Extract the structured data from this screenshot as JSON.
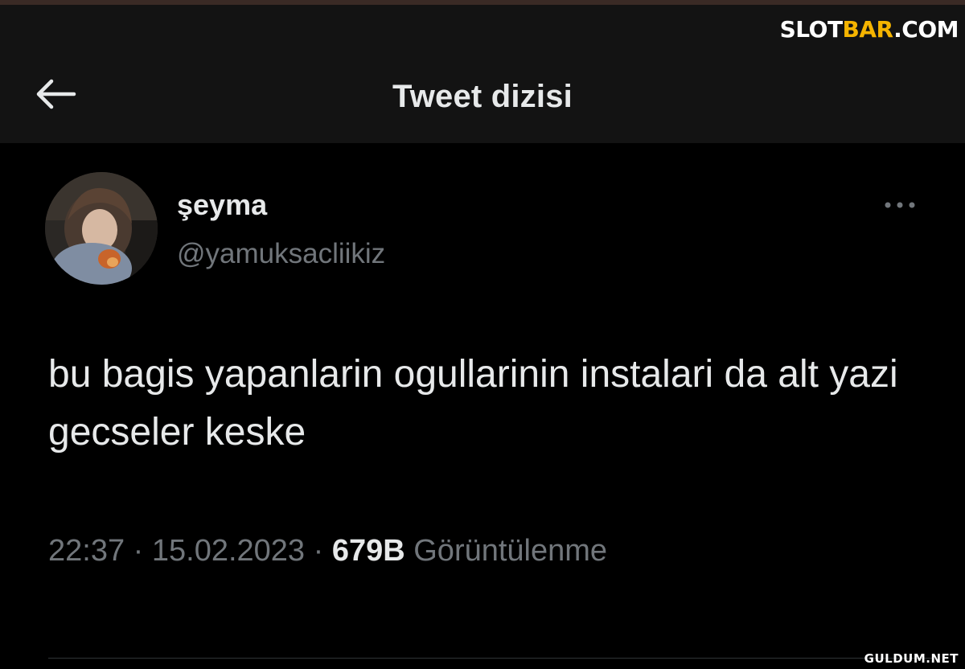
{
  "header": {
    "title": "Tweet dizisi",
    "back_icon": "arrow-left-icon"
  },
  "watermark": {
    "part1": "SLOT",
    "part2": "BAR",
    "part3": ".COM",
    "accent": "#f5b400"
  },
  "tweet": {
    "display_name": "şeyma",
    "handle": "@yamuksacliikiz",
    "text": "bu bagis yapanlarin ogullarinin instalari da alt yazi gecseler keske",
    "time": "22:37",
    "date": "15.02.2023",
    "views_count": "679B",
    "views_label": "Görüntülenme",
    "separator": "·",
    "more_icon": "more-horizontal-icon"
  },
  "footer": {
    "site_mark": "GULDUM.NET"
  },
  "colors": {
    "background": "#000000",
    "header_background": "#131313",
    "primary_text": "#e7e9ea",
    "secondary_text": "#71767b"
  }
}
